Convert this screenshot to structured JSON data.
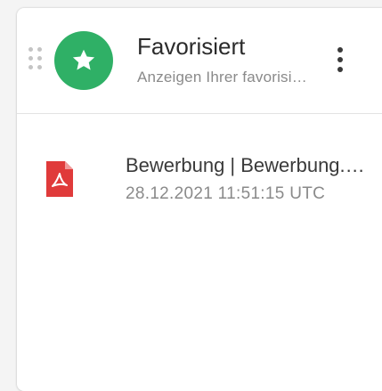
{
  "widget": {
    "title": "Favorisiert",
    "subtitle": "Anzeigen Ihrer favorisierten Dateien",
    "icon": "star-icon",
    "icon_color": "#2fb066"
  },
  "items": [
    {
      "name": "Bewerbung | Bewerbung.pdf",
      "timestamp": "28.12.2021 11:51:15 UTC",
      "icon": "pdf-file-icon",
      "icon_color": "#e03a3a"
    }
  ]
}
